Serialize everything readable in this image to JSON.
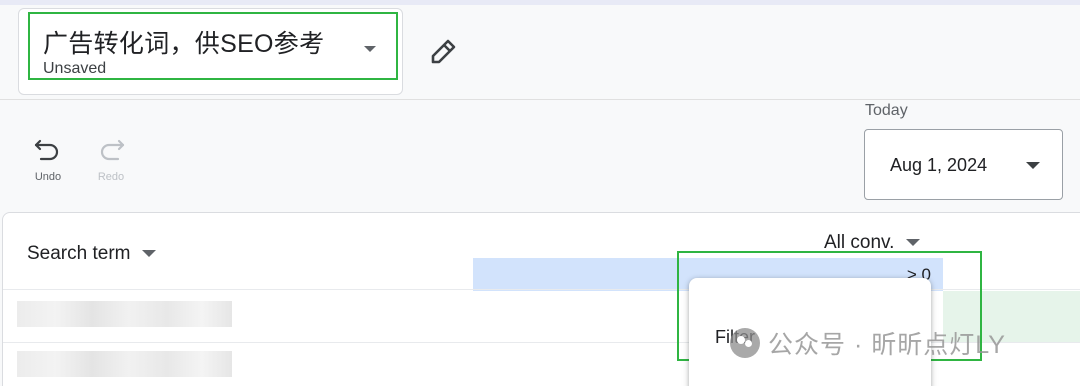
{
  "report": {
    "title": "广告转化词，供SEO参考",
    "status": "Unsaved"
  },
  "toolbar": {
    "undo_label": "Undo",
    "redo_label": "Redo"
  },
  "date_range": {
    "label": "Today",
    "value": "Aug 1, 2024"
  },
  "table": {
    "columns": [
      {
        "label": "Search term"
      },
      {
        "label": "All conv."
      }
    ],
    "filter_condition": "> 0"
  },
  "popup": {
    "item_label": "Filter"
  },
  "watermark": {
    "text": "公众号 · 昕昕点灯LY"
  },
  "colors": {
    "highlight": "#2fb542",
    "filter_bar": "#d2e3fc",
    "positive_cell": "#e6f4ea"
  }
}
